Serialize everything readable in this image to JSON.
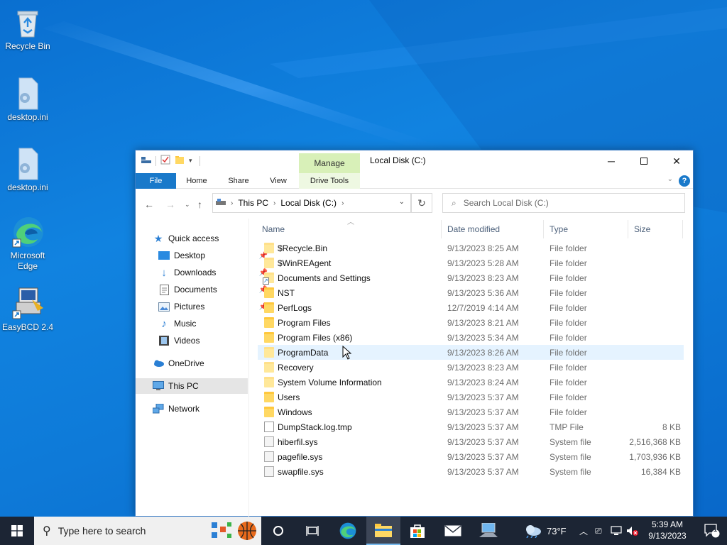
{
  "desktop": {
    "icons": [
      {
        "label": "Recycle Bin",
        "icon": "recycle-bin-icon"
      },
      {
        "label": "desktop.ini",
        "icon": "settings-file-icon"
      },
      {
        "label": "desktop.ini",
        "icon": "settings-file-icon"
      },
      {
        "label": "Microsoft Edge",
        "icon": "edge-icon"
      },
      {
        "label": "EasyBCD 2.4",
        "icon": "easybcd-icon"
      }
    ]
  },
  "window": {
    "title": "Local Disk (C:)",
    "contextual_group": "Manage",
    "ribbon_tabs": {
      "file": "File",
      "home": "Home",
      "share": "Share",
      "view": "View",
      "drive_tools": "Drive Tools"
    },
    "breadcrumb": [
      "This PC",
      "Local Disk (C:)"
    ],
    "search_placeholder": "Search Local Disk (C:)",
    "nav": {
      "quick_access": "Quick access",
      "desktop": "Desktop",
      "downloads": "Downloads",
      "documents": "Documents",
      "pictures": "Pictures",
      "music": "Music",
      "videos": "Videos",
      "onedrive": "OneDrive",
      "this_pc": "This PC",
      "network": "Network"
    },
    "columns": {
      "name": "Name",
      "date": "Date modified",
      "type": "Type",
      "size": "Size"
    },
    "files": [
      {
        "name": "$Recycle.Bin",
        "date": "9/13/2023 8:25 AM",
        "type": "File folder",
        "size": "",
        "kind": "folder-light"
      },
      {
        "name": "$WinREAgent",
        "date": "9/13/2023 5:28 AM",
        "type": "File folder",
        "size": "",
        "kind": "folder-light"
      },
      {
        "name": "Documents and Settings",
        "date": "9/13/2023 8:23 AM",
        "type": "File folder",
        "size": "",
        "kind": "folder-link"
      },
      {
        "name": "NST",
        "date": "9/13/2023 5:36 AM",
        "type": "File folder",
        "size": "",
        "kind": "folder"
      },
      {
        "name": "PerfLogs",
        "date": "12/7/2019 4:14 AM",
        "type": "File folder",
        "size": "",
        "kind": "folder"
      },
      {
        "name": "Program Files",
        "date": "9/13/2023 8:21 AM",
        "type": "File folder",
        "size": "",
        "kind": "folder"
      },
      {
        "name": "Program Files (x86)",
        "date": "9/13/2023 5:34 AM",
        "type": "File folder",
        "size": "",
        "kind": "folder"
      },
      {
        "name": "ProgramData",
        "date": "9/13/2023 8:26 AM",
        "type": "File folder",
        "size": "",
        "kind": "folder-light"
      },
      {
        "name": "Recovery",
        "date": "9/13/2023 8:23 AM",
        "type": "File folder",
        "size": "",
        "kind": "folder-light"
      },
      {
        "name": "System Volume Information",
        "date": "9/13/2023 8:24 AM",
        "type": "File folder",
        "size": "",
        "kind": "folder-light"
      },
      {
        "name": "Users",
        "date": "9/13/2023 5:37 AM",
        "type": "File folder",
        "size": "",
        "kind": "folder"
      },
      {
        "name": "Windows",
        "date": "9/13/2023 5:37 AM",
        "type": "File folder",
        "size": "",
        "kind": "folder"
      },
      {
        "name": "DumpStack.log.tmp",
        "date": "9/13/2023 5:37 AM",
        "type": "TMP File",
        "size": "8 KB",
        "kind": "file"
      },
      {
        "name": "hiberfil.sys",
        "date": "9/13/2023 5:37 AM",
        "type": "System file",
        "size": "2,516,368 KB",
        "kind": "sys"
      },
      {
        "name": "pagefile.sys",
        "date": "9/13/2023 5:37 AM",
        "type": "System file",
        "size": "1,703,936 KB",
        "kind": "sys"
      },
      {
        "name": "swapfile.sys",
        "date": "9/13/2023 5:37 AM",
        "type": "System file",
        "size": "16,384 KB",
        "kind": "sys"
      }
    ],
    "hovered_row": 7
  },
  "taskbar": {
    "search_placeholder": "Type here to search",
    "weather": "73°F",
    "time": "5:39 AM",
    "date": "9/13/2023",
    "notification_count": "1"
  },
  "colors": {
    "accent": "#1979ca",
    "taskbar": "#1c2534",
    "folder": "#ffd863"
  }
}
